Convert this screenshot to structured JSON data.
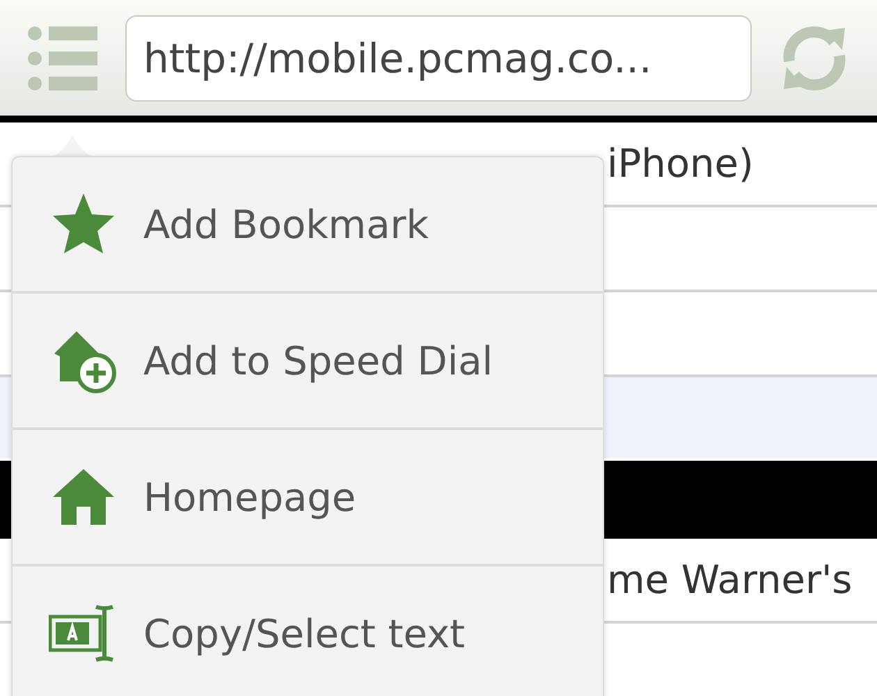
{
  "toolbar": {
    "url": "http://mobile.pcmag.co..."
  },
  "page": {
    "rows": [
      {
        "kind": "text",
        "text": "iPhone)"
      },
      {
        "kind": "blank"
      },
      {
        "kind": "blank"
      },
      {
        "kind": "highlight"
      },
      {
        "kind": "banner"
      },
      {
        "kind": "text",
        "text": "me Warner's"
      }
    ]
  },
  "menu": {
    "items": [
      {
        "kind": "star",
        "label": "Add Bookmark"
      },
      {
        "kind": "speed-dial",
        "label": "Add to Speed Dial"
      },
      {
        "kind": "home",
        "label": "Homepage"
      },
      {
        "kind": "select-text",
        "label": "Copy/Select text"
      }
    ]
  }
}
